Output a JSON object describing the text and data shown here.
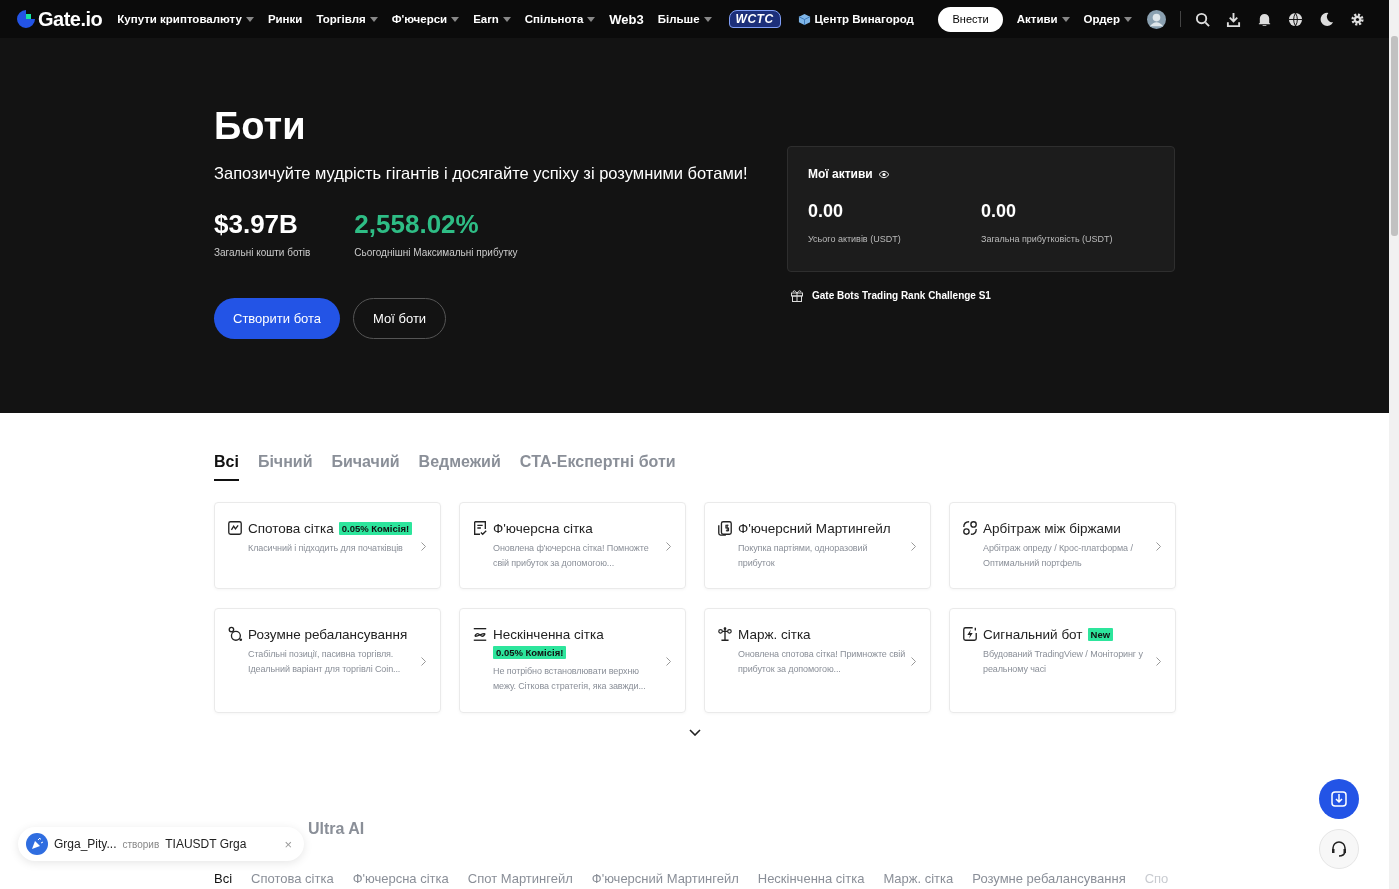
{
  "nav": {
    "logo": "Gate.io",
    "items": [
      {
        "label": "Купути криптовалюту",
        "dropdown": true
      },
      {
        "label": "Ринки",
        "dropdown": false
      },
      {
        "label": "Торгівля",
        "dropdown": true
      },
      {
        "label": "Ф'ючерси",
        "dropdown": true
      },
      {
        "label": "Earn",
        "dropdown": true
      },
      {
        "label": "Спільнота",
        "dropdown": true
      },
      {
        "label": "Web3",
        "dropdown": false
      },
      {
        "label": "Більше",
        "dropdown": true
      }
    ],
    "badge": "WCTC",
    "rewards": "Центр Винагород",
    "deposit": "Внести",
    "right_items": [
      {
        "label": "Активи",
        "dropdown": true
      },
      {
        "label": "Ордер",
        "dropdown": true
      }
    ]
  },
  "hero": {
    "title": "Боти",
    "subtitle": "Запозичуйте мудрість гігантів і досягайте успіху зі розумними ботами!",
    "stats": [
      {
        "value": "$3.97B",
        "label": "Загальні кошти ботів",
        "kind": "plain"
      },
      {
        "value": "2,558.02%",
        "label": "Сьогоднішні Максимальні прибутку",
        "kind": "gain"
      }
    ],
    "buttons": [
      {
        "label": "Створити бота",
        "kind": "primary"
      },
      {
        "label": "Мої боти",
        "kind": "outline"
      }
    ],
    "assets": {
      "title": "Мої активи",
      "items": [
        {
          "value": "0.00",
          "label": "Усього активів (USDT)"
        },
        {
          "value": "0.00",
          "label": "Загальна прибутковість (USDT)"
        }
      ]
    },
    "promo": "Gate Bots Trading Rank Challenge S1"
  },
  "tabs": [
    {
      "label": "Всі",
      "selected": true
    },
    {
      "label": "Бічний",
      "selected": false
    },
    {
      "label": "Бичачий",
      "selected": false
    },
    {
      "label": "Ведмежий",
      "selected": false
    },
    {
      "label": "CTA-Експертні боти",
      "selected": false
    }
  ],
  "bots": [
    {
      "kind": "inline",
      "title": "Спотова сітка",
      "badge": "0.05% Комісія!",
      "desc": "Класичний і підходить для початківців"
    },
    {
      "kind": "plain",
      "title": "Ф'ючерсна сітка",
      "desc": "Оновлена ф'ючерсна сітка! Помножте свій прибуток за допомогою..."
    },
    {
      "kind": "plain",
      "title": "Ф'ючерсний Мартингейл",
      "desc": "Покупка партіями, одноразовий прибуток"
    },
    {
      "kind": "plain",
      "title": "Арбітраж між біржами",
      "desc": "Арбітраж опреду / Крос-платформа / Оптимальний портфель"
    },
    {
      "kind": "plain",
      "title": "Розумне ребалансування",
      "desc": "Стабільні позиції, пасивна торгівля. Ідеальний варіант для торгівлі Coin..."
    },
    {
      "kind": "stacked",
      "title": "Нескінченна сітка",
      "badge": "0.05% Комісія!",
      "desc": "Не потрібно встановлювати верхню межу. Сіткова стратегія, яка завжди..."
    },
    {
      "kind": "plain",
      "title": "Марж. сітка",
      "desc": "Оновлена спотова сітка! Примножте свій прибуток за допомогою..."
    },
    {
      "kind": "inline",
      "title": "Сигнальний бот",
      "badge": "New",
      "desc": "Вбудований TradingView / Моніторинг у реальному часі"
    }
  ],
  "pool": {
    "heading_tabs": [
      {
        "label": "Ultra AI",
        "selected": false
      }
    ],
    "filters": [
      {
        "label": "Всі",
        "selected": true
      },
      {
        "label": "Спотова сітка",
        "selected": false
      },
      {
        "label": "Ф'ючерсна сітка",
        "selected": false
      },
      {
        "label": "Спот Мартингейл",
        "selected": false
      },
      {
        "label": "Ф'ючерсний Мартингейл",
        "selected": false
      },
      {
        "label": "Нескінченна сітка",
        "selected": false
      },
      {
        "label": "Марж. сітка",
        "selected": false
      },
      {
        "label": "Розумне ребалансування",
        "selected": false
      },
      {
        "label": "Спо",
        "selected": false
      }
    ]
  },
  "toast": {
    "user": "Grga_Pity...",
    "action": "створив",
    "text": "TIAUSDT Grga",
    "close": "×"
  }
}
